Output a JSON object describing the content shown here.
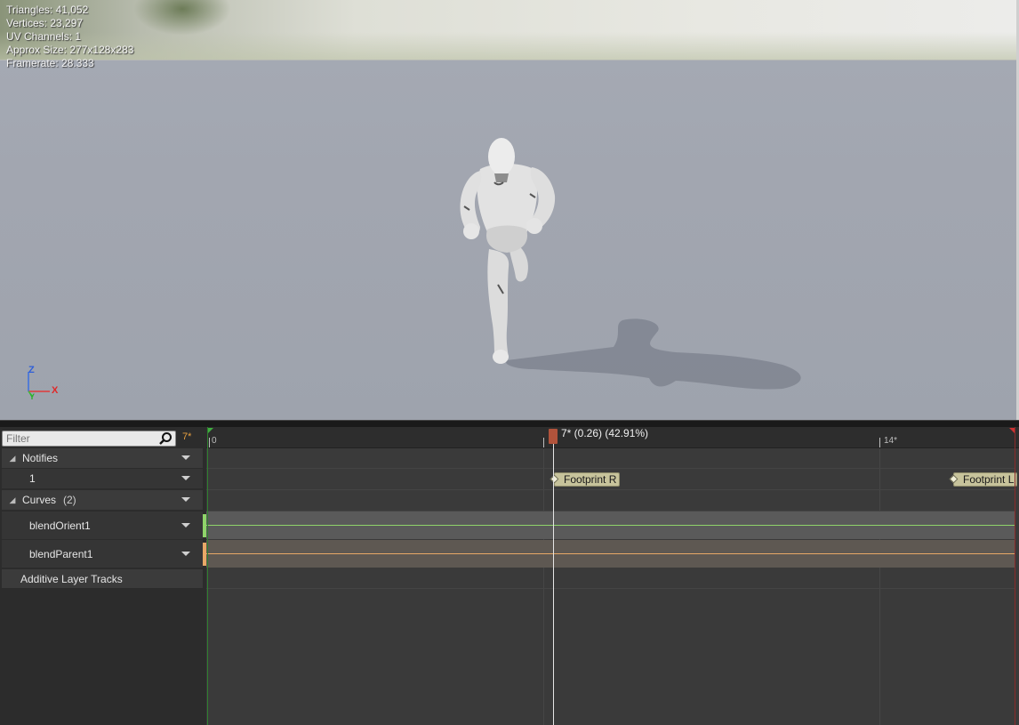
{
  "viewport": {
    "stats": [
      "Triangles: 41,052",
      "Vertices: 23,297",
      "UV Channels: 1",
      "Approx Size: 277x128x283",
      "Framerate: 28.333"
    ],
    "axis": {
      "z": "Z",
      "x": "X",
      "y": "Y"
    }
  },
  "track_panel": {
    "filter_placeholder": "Filter",
    "current_frame": "7*",
    "notifies_label": "Notifies",
    "notify_track_label": "1",
    "curves_label": "Curves",
    "curves_count": "(2)",
    "curves": [
      {
        "name": "blendOrient1",
        "color": "#8fd46a"
      },
      {
        "name": "blendParent1",
        "color": "#e8a867"
      }
    ],
    "additive_label": "Additive Layer Tracks"
  },
  "timeline": {
    "ruler_start": "0",
    "ruler_mid": "14*",
    "playhead_text": "7* (0.26) (42.91%)",
    "notifies": [
      {
        "label": "Footprint R"
      },
      {
        "label": "Footprint L"
      }
    ]
  },
  "colors": {
    "accent": "#e8a040",
    "playhead": "#b1533b",
    "notify_bg": "#c7c39b",
    "start_marker": "#3fae3f",
    "end_marker": "#cc3333"
  }
}
